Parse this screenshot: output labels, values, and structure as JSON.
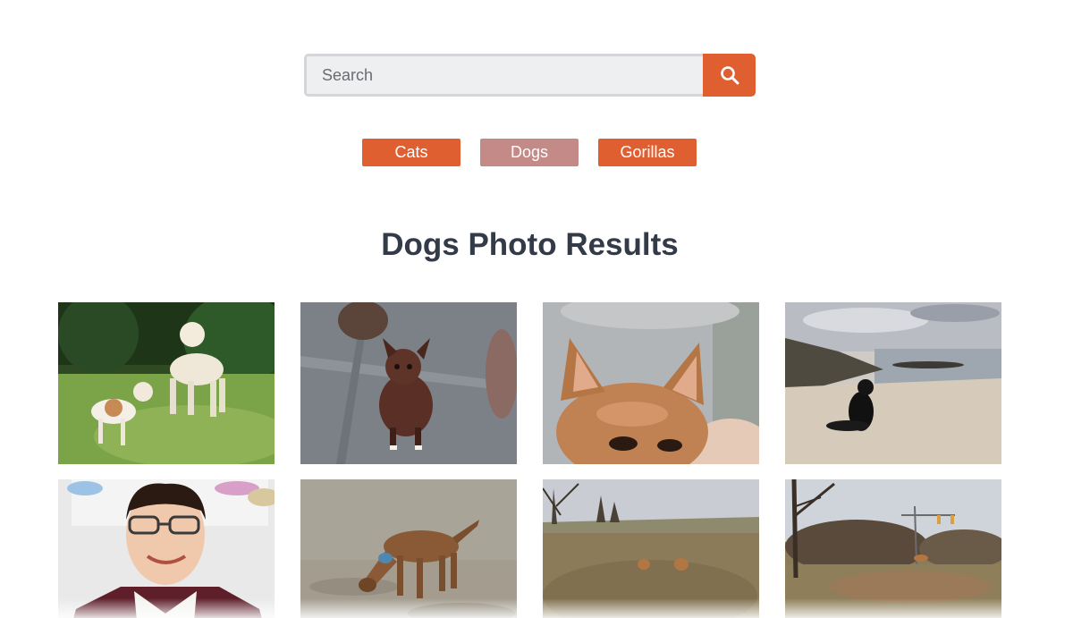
{
  "search": {
    "placeholder": "Search",
    "button_icon": "search-icon"
  },
  "categories": [
    "Cats",
    "Dogs",
    "Gorillas"
  ],
  "active_category": "Dogs",
  "colors": {
    "accent": "#e05f31",
    "active_tag": "#c38a87",
    "title": "#333b48"
  },
  "results_title": "Dogs Photo Results"
}
